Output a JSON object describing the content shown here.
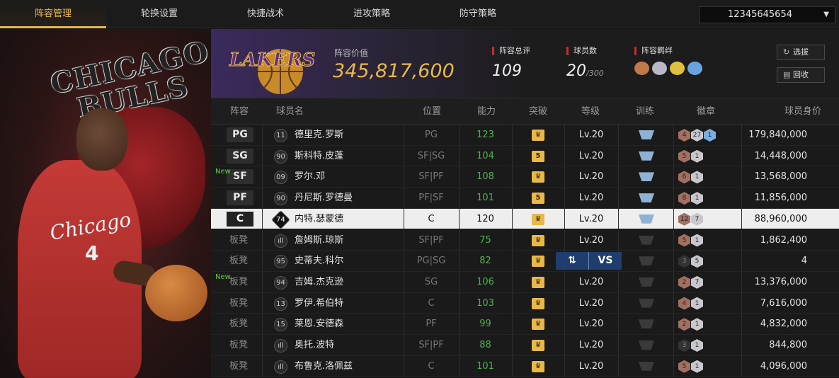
{
  "nav": {
    "tabs": [
      "阵容管理",
      "轮换设置",
      "快捷战术",
      "进攻策略",
      "防守策略"
    ],
    "account": "12345645654"
  },
  "hero": {
    "name_line1": "CHICAGO",
    "name_line2": "BULLS",
    "jersey_text": "Chicago",
    "jersey_number": "4"
  },
  "team": {
    "logo_text": "LAKERS",
    "value_label": "阵容价值",
    "value": "345,817,600",
    "total_rating_label": "阵容总评",
    "total_rating": "109",
    "player_count_label": "球员数",
    "player_count": "20",
    "player_count_max": "/300",
    "bond_label": "阵容羁绊",
    "btn_pick": "选拔",
    "btn_recycle": "回收"
  },
  "table": {
    "headers": [
      "阵容",
      "球员名",
      "位置",
      "能力",
      "突破",
      "等级",
      "训练",
      "徽章",
      "球员身价"
    ],
    "rows": [
      {
        "slot": "PG",
        "bench": false,
        "new": false,
        "num": "11",
        "name": "德里克.罗斯",
        "pos": "PG",
        "rating": "123",
        "brk": "♛",
        "level": "Lv.20",
        "train": true,
        "badges": [
          "4",
          "27",
          "1"
        ],
        "price": "179,840,000"
      },
      {
        "slot": "SG",
        "bench": false,
        "new": false,
        "num": "90",
        "name": "斯科特.皮蓬",
        "pos": "SF|SG",
        "rating": "104",
        "brk": "5",
        "level": "Lv.20",
        "train": true,
        "badges": [
          "5",
          "1"
        ],
        "price": "14,448,000"
      },
      {
        "slot": "SF",
        "bench": false,
        "new": true,
        "num": "09",
        "name": "罗尔.邓",
        "pos": "SF|PF",
        "rating": "108",
        "brk": "♛",
        "level": "Lv.20",
        "train": true,
        "badges": [
          "6",
          "1"
        ],
        "price": "13,568,000"
      },
      {
        "slot": "PF",
        "bench": false,
        "new": false,
        "num": "90",
        "name": "丹尼斯.罗德曼",
        "pos": "PF|SF",
        "rating": "101",
        "brk": "5",
        "level": "Lv.20",
        "train": true,
        "badges": [
          "8",
          "1"
        ],
        "price": "11,856,000"
      },
      {
        "slot": "C",
        "bench": false,
        "new": false,
        "num": "74",
        "name": "内特.瑟蒙德",
        "pos": "C",
        "rating": "120",
        "brk": "♛",
        "level": "Lv.20",
        "train": true,
        "badges": [
          "12",
          "7"
        ],
        "price": "88,960,000"
      },
      {
        "slot": "板凳",
        "bench": true,
        "new": false,
        "num": "ıll",
        "name": "詹姆斯.琼斯",
        "pos": "SF|PF",
        "rating": "75",
        "brk": "♛",
        "level": "Lv.20",
        "train": false,
        "badges": [
          "5",
          "1"
        ],
        "price": "1,862,400"
      },
      {
        "slot": "板凳",
        "bench": true,
        "new": false,
        "num": "95",
        "name": "史蒂夫.科尔",
        "pos": "PG|SG",
        "rating": "82",
        "brk": "♛",
        "level": "Lv.20",
        "train": false,
        "badges": [
          "3",
          "5"
        ],
        "price": "4"
      },
      {
        "slot": "板凳",
        "bench": true,
        "new": true,
        "num": "94",
        "name": "吉姆.杰克逊",
        "pos": "SG",
        "rating": "106",
        "brk": "♛",
        "level": "Lv.20",
        "train": false,
        "badges": [
          "2",
          "7"
        ],
        "price": "13,376,000"
      },
      {
        "slot": "板凳",
        "bench": true,
        "new": false,
        "num": "13",
        "name": "罗伊.希伯特",
        "pos": "C",
        "rating": "103",
        "brk": "♛",
        "level": "Lv.20",
        "train": false,
        "badges": [
          "4",
          "1"
        ],
        "price": "7,616,000"
      },
      {
        "slot": "板凳",
        "bench": true,
        "new": false,
        "num": "15",
        "name": "莱恩.安德森",
        "pos": "PF",
        "rating": "99",
        "brk": "♛",
        "level": "Lv.20",
        "train": false,
        "badges": [
          "2",
          "1"
        ],
        "price": "4,832,000"
      },
      {
        "slot": "板凳",
        "bench": true,
        "new": false,
        "num": "ıll",
        "name": "奥托.波特",
        "pos": "SF|PF",
        "rating": "88",
        "brk": "♛",
        "level": "Lv.20",
        "train": false,
        "badges": [
          "3",
          "1"
        ],
        "price": "844,800"
      },
      {
        "slot": "板凳",
        "bench": true,
        "new": false,
        "num": "ıll",
        "name": "布鲁克.洛佩兹",
        "pos": "C",
        "rating": "101",
        "brk": "♛",
        "level": "Lv.20",
        "train": false,
        "badges": [
          "5",
          "1"
        ],
        "price": "4,096,000"
      }
    ],
    "new_label": "New",
    "selected_index": 4
  },
  "compare": {
    "swap_icon": "swap-icon",
    "vs_label": "VS"
  },
  "colors": {
    "accent": "#e8b84a",
    "green": "#4fb24e",
    "purple": "#3b2a5c"
  }
}
